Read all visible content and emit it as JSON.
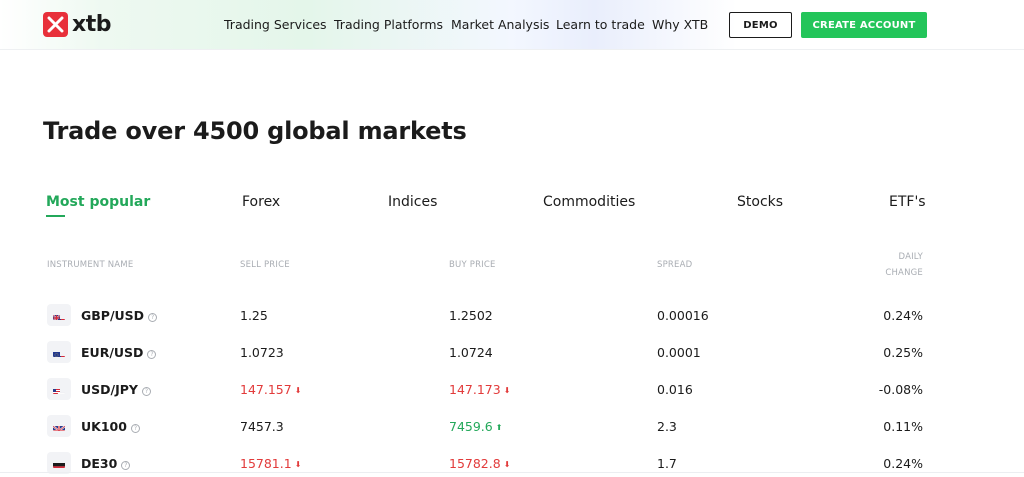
{
  "header": {
    "logo_text": "xtb",
    "nav": [
      "Trading Services",
      "Trading Platforms",
      "Market Analysis",
      "Learn to trade",
      "Why XTB"
    ],
    "demo_label": "DEMO",
    "create_label": "CREATE ACCOUNT",
    "colors": {
      "brand_red": "#e8303a",
      "accent_green": "#23c55a"
    }
  },
  "title": "Trade over 4500 global markets",
  "tabs": [
    "Most popular",
    "Forex",
    "Indices",
    "Commodities",
    "Stocks",
    "ETF's"
  ],
  "table": {
    "headers": {
      "instrument": "INSTRUMENT NAME",
      "sell": "SELL PRICE",
      "buy": "BUY PRICE",
      "spread": "SPREAD",
      "daily_line1": "DAILY",
      "daily_line2": "CHANGE"
    },
    "rows": [
      {
        "name": "GBP/USD",
        "sell": "1.25",
        "sell_dir": "none",
        "buy": "1.2502",
        "buy_dir": "none",
        "spread": "0.00016",
        "change": "0.24%",
        "flag": "gb-us"
      },
      {
        "name": "EUR/USD",
        "sell": "1.0723",
        "sell_dir": "none",
        "buy": "1.0724",
        "buy_dir": "none",
        "spread": "0.0001",
        "change": "0.25%",
        "flag": "eu-us"
      },
      {
        "name": "USD/JPY",
        "sell": "147.157",
        "sell_dir": "down",
        "buy": "147.173",
        "buy_dir": "down",
        "spread": "0.016",
        "change": "-0.08%",
        "flag": "us-jp"
      },
      {
        "name": "UK100",
        "sell": "7457.3",
        "sell_dir": "none",
        "buy": "7459.6",
        "buy_dir": "up",
        "spread": "2.3",
        "change": "0.11%",
        "flag": "gb"
      },
      {
        "name": "DE30",
        "sell": "15781.1",
        "sell_dir": "down",
        "buy": "15782.8",
        "buy_dir": "down",
        "spread": "1.7",
        "change": "0.24%",
        "flag": "de"
      }
    ]
  }
}
